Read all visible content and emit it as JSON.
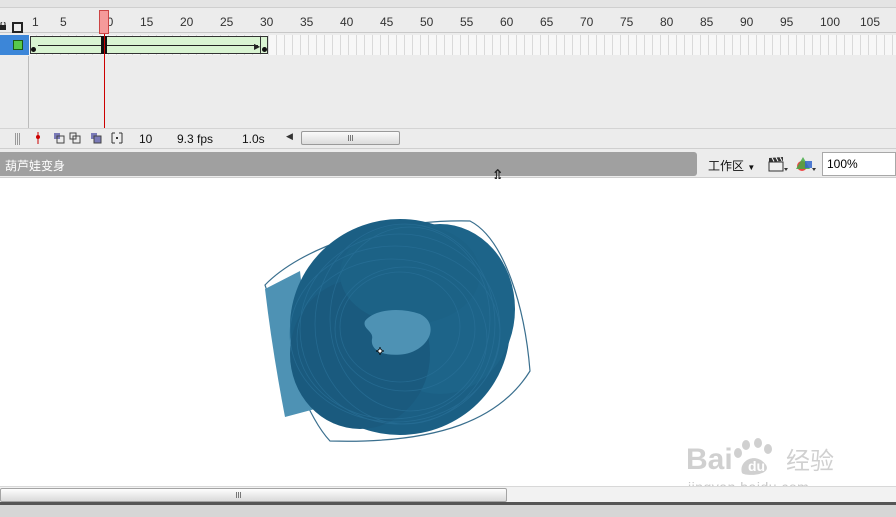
{
  "timeline": {
    "ruler_numbers": [
      "1",
      "5",
      "10",
      "15",
      "20",
      "25",
      "30",
      "35",
      "40",
      "45",
      "50",
      "55",
      "60",
      "65",
      "70",
      "75",
      "80",
      "85",
      "90",
      "95",
      "100",
      "105"
    ],
    "current_frame": 10,
    "tween_frames": [
      1,
      30
    ],
    "layer_color": "#58c84c",
    "selection_color": "#3c86d8",
    "playhead_color": "#cc0000"
  },
  "statusbar": {
    "frame": "10",
    "fps": "9.3 fps",
    "time": "1.0s"
  },
  "editbar": {
    "scene_name": "葫芦娃变身",
    "workspace_label": "工作区",
    "zoom": "100%"
  },
  "stage": {
    "shape_fill": "#1b5f84",
    "shape_light": "#4e92b4"
  }
}
